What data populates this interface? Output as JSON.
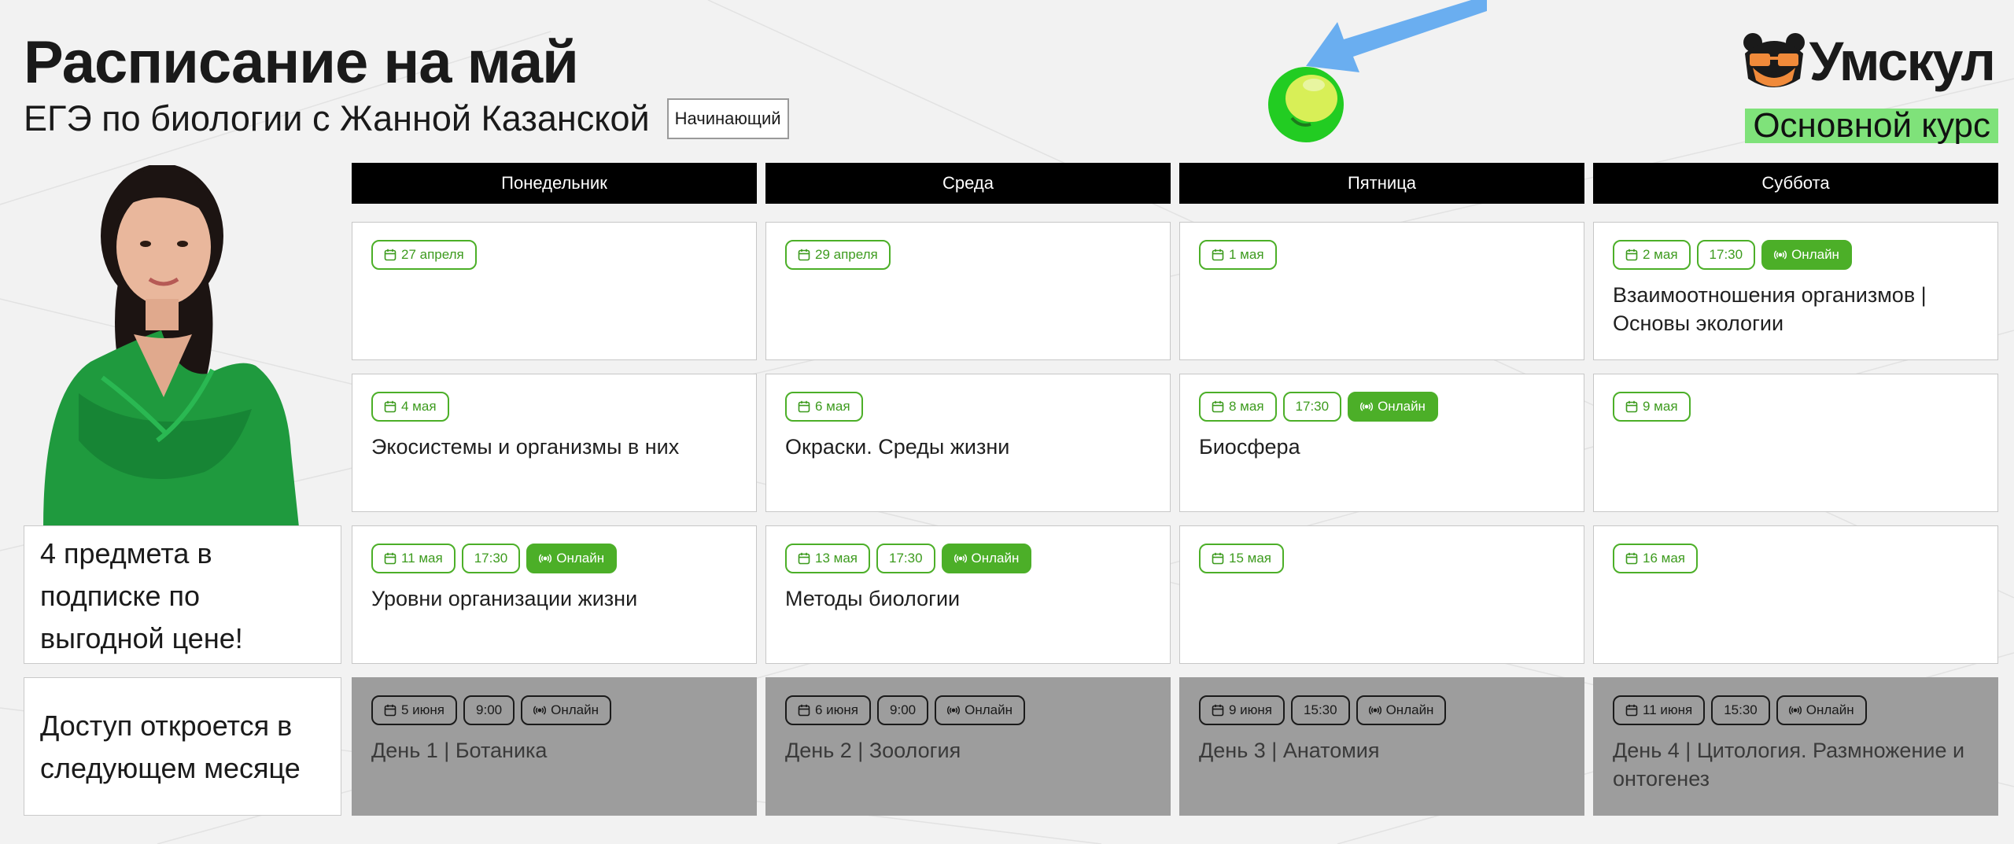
{
  "header": {
    "title": "Расписание на май",
    "subtitle": "ЕГЭ по биологии с Жанной Казанской",
    "level": "Начинающий"
  },
  "brand": {
    "name": "Умскул",
    "course": "Основной курс",
    "accent_color": "#4caf28",
    "highlight_color": "#7fe27a"
  },
  "promo": {
    "subscription": "4 предмета в подписке по выгодной цене!",
    "access": "Доступ откроется в следующем месяце"
  },
  "days": [
    "Понедельник",
    "Среда",
    "Пятница",
    "Суббота"
  ],
  "schedule": [
    [
      {
        "date": "27 апреля",
        "time": "",
        "online": "",
        "title": "",
        "locked": false
      },
      {
        "date": "29 апреля",
        "time": "",
        "online": "",
        "title": "",
        "locked": false
      },
      {
        "date": "1 мая",
        "time": "",
        "online": "",
        "title": "",
        "locked": false
      },
      {
        "date": "2 мая",
        "time": "17:30",
        "online": "Онлайн",
        "title": "Взаимоотношения организмов | Основы экологии",
        "locked": false
      }
    ],
    [
      {
        "date": "4 мая",
        "time": "",
        "online": "",
        "title": "Экосистемы и организмы в них",
        "locked": false
      },
      {
        "date": "6 мая",
        "time": "",
        "online": "",
        "title": "Окраски. Среды жизни",
        "locked": false
      },
      {
        "date": "8 мая",
        "time": "17:30",
        "online": "Онлайн",
        "title": "Биосфера",
        "locked": false
      },
      {
        "date": "9 мая",
        "time": "",
        "online": "",
        "title": "",
        "locked": false
      }
    ],
    [
      {
        "date": "11 мая",
        "time": "17:30",
        "online": "Онлайн",
        "title": "Уровни организации жизни",
        "locked": false
      },
      {
        "date": "13 мая",
        "time": "17:30",
        "online": "Онлайн",
        "title": "Методы биологии",
        "locked": false
      },
      {
        "date": "15 мая",
        "time": "",
        "online": "",
        "title": "",
        "locked": false
      },
      {
        "date": "16 мая",
        "time": "",
        "online": "",
        "title": "",
        "locked": false
      }
    ],
    [
      {
        "date": "5 июня",
        "time": "9:00",
        "online": "Онлайн",
        "title": "День 1 | Ботаника",
        "locked": true
      },
      {
        "date": "6 июня",
        "time": "9:00",
        "online": "Онлайн",
        "title": "День 2 | Зоология",
        "locked": true
      },
      {
        "date": "9 июня",
        "time": "15:30",
        "online": "Онлайн",
        "title": "День 3 | Анатомия",
        "locked": true
      },
      {
        "date": "11 июня",
        "time": "15:30",
        "online": "Онлайн",
        "title": "День 4 | Цитология. Размножение и онтогенез",
        "locked": true
      }
    ]
  ],
  "icons": {
    "calendar": "calendar-icon",
    "online": "broadcast-icon",
    "brand": "bear-logo-icon",
    "arrow": "arrow-pointer-icon",
    "ball": "green-ball-icon"
  }
}
